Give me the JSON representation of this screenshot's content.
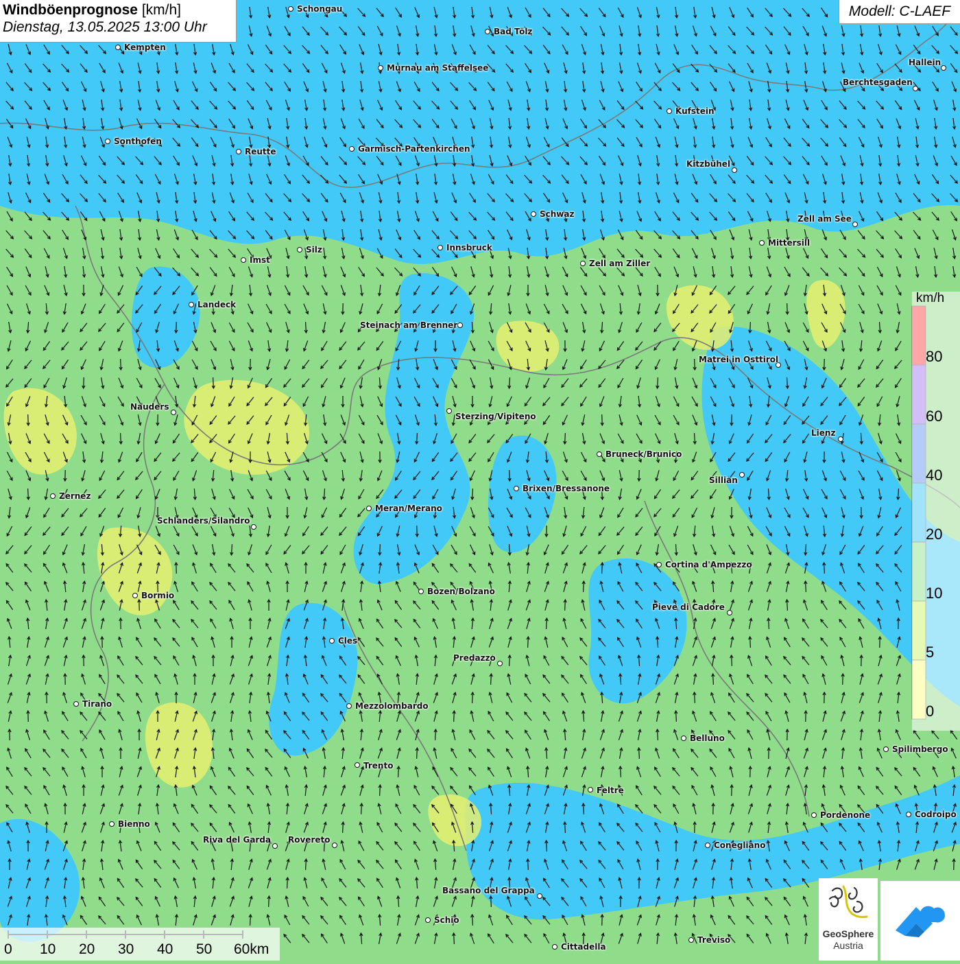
{
  "header": {
    "title": "Windböenprognose",
    "unit": "[km/h]",
    "datetime": "Dienstag, 13.05.2025 13:00 Uhr",
    "model": "Modell: C-LAEF"
  },
  "legend": {
    "unit": "km/h",
    "ticks": [
      "80",
      "60",
      "40",
      "20",
      "10",
      "5",
      "0"
    ],
    "colors": [
      "#ff3a3a",
      "#a070ee",
      "#5b8ff0",
      "#2ec0f5",
      "#84e283",
      "#c8f25c",
      "#ffff7a"
    ]
  },
  "scalebar": {
    "labels": [
      "0",
      "10",
      "20",
      "30",
      "40",
      "50",
      "60km"
    ]
  },
  "colors": {
    "calm": "#8fdc8a",
    "breezy": "#42c9f7",
    "light": "#e6ef70",
    "border": "#7a7a7a",
    "arrow": "#111111"
  },
  "logos": {
    "geosphere_name": "GeoSphere",
    "geosphere_sub": "Austria",
    "geosphere_icon": "geosphere-logo-icon",
    "wetter_icon": "weather-app-logo-icon"
  },
  "cities": [
    {
      "name": "Schongau"
    },
    {
      "name": "Bad Tölz"
    },
    {
      "name": "Kempten"
    },
    {
      "name": "Murnau am Staffelsee"
    },
    {
      "name": "Hallein"
    },
    {
      "name": "Berchtesgaden"
    },
    {
      "name": "Kufstein"
    },
    {
      "name": "Sonthofen"
    },
    {
      "name": "Reutte"
    },
    {
      "name": "Garmisch-Partenkirchen"
    },
    {
      "name": "Kitzbühel"
    },
    {
      "name": "Schwaz"
    },
    {
      "name": "Zell am See"
    },
    {
      "name": "Mittersill"
    },
    {
      "name": "Innsbruck"
    },
    {
      "name": "Imst"
    },
    {
      "name": "Silz"
    },
    {
      "name": "Zell am Ziller"
    },
    {
      "name": "Landeck"
    },
    {
      "name": "Steinach am Brenner"
    },
    {
      "name": "Matrei in Osttirol"
    },
    {
      "name": "Nauders"
    },
    {
      "name": "Sterzing/Vipiteno"
    },
    {
      "name": "Lienz"
    },
    {
      "name": "Bruneck/Brunico"
    },
    {
      "name": "Sillian"
    },
    {
      "name": "Brixen/Bressanone"
    },
    {
      "name": "Zernez"
    },
    {
      "name": "Meran/Merano"
    },
    {
      "name": "Schlanders/Silandro"
    },
    {
      "name": "Cortina d'Ampezzo"
    },
    {
      "name": "Bozen/Bolzano"
    },
    {
      "name": "Bormio"
    },
    {
      "name": "Pieve di Cadore"
    },
    {
      "name": "Cles"
    },
    {
      "name": "Predazzo"
    },
    {
      "name": "Tirano"
    },
    {
      "name": "Mezzolombardo"
    },
    {
      "name": "Belluno"
    },
    {
      "name": "Spilimbergo"
    },
    {
      "name": "Trento"
    },
    {
      "name": "Feltre"
    },
    {
      "name": "Pordenone"
    },
    {
      "name": "Codroipo"
    },
    {
      "name": "Bienno"
    },
    {
      "name": "Riva del Garda"
    },
    {
      "name": "Rovereto"
    },
    {
      "name": "Conegliano"
    },
    {
      "name": "Bassano del Grappa"
    },
    {
      "name": "Schio"
    },
    {
      "name": "Treviso"
    },
    {
      "name": "Cittadella"
    }
  ]
}
